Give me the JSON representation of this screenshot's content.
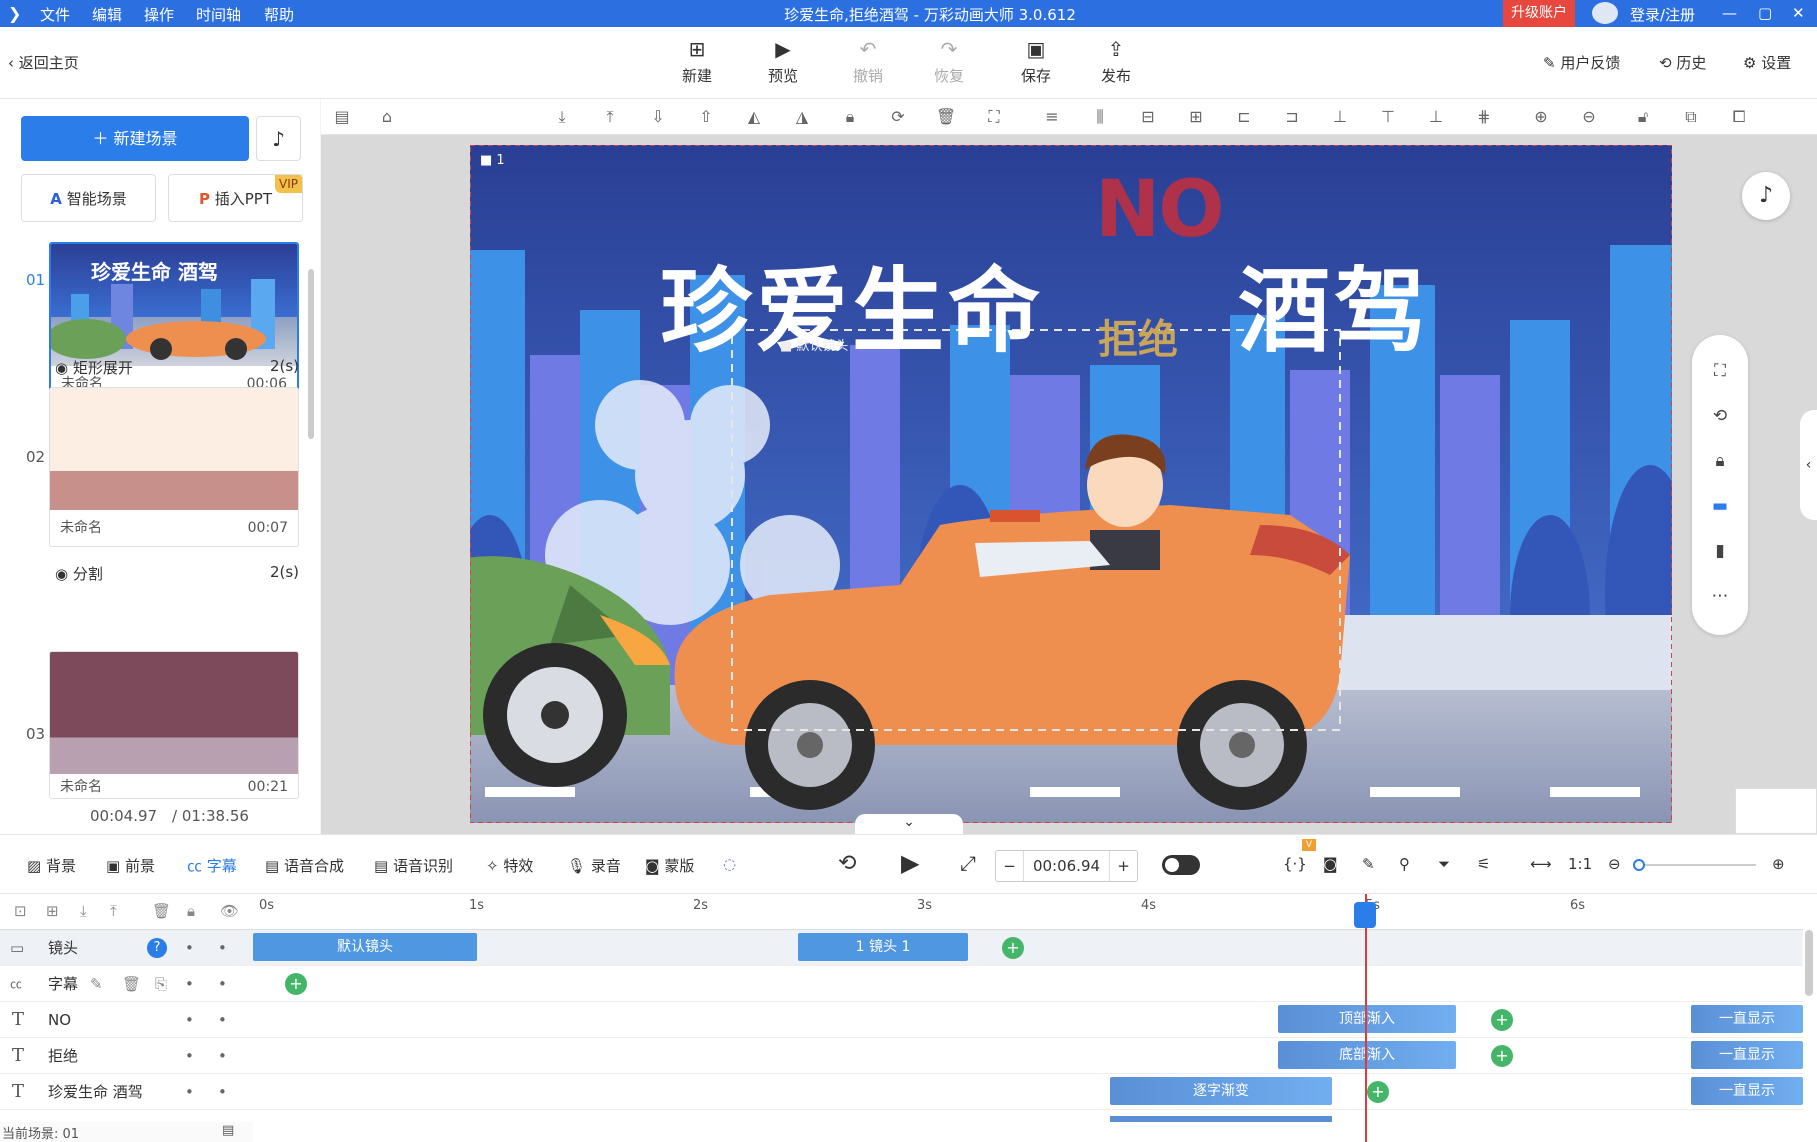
{
  "titlebar": {
    "menus": [
      "文件",
      "编辑",
      "操作",
      "时间轴",
      "帮助"
    ],
    "title": "珍爱生命,拒绝酒驾 - 万彩动画大师 3.0.612",
    "upgrade": "升级账户",
    "login": "登录/注册"
  },
  "toolbar": {
    "back": "返回主页",
    "new": "新建",
    "preview": "预览",
    "undo": "撤销",
    "redo": "恢复",
    "save": "保存",
    "publish": "发布",
    "feedback": "用户反馈",
    "history": "历史",
    "settings": "设置"
  },
  "left": {
    "new_scene": "新建场景",
    "smart_scene": "智能场景",
    "insert_ppt": "插入PPT",
    "vip": "VIP",
    "scenes": [
      {
        "num": "01",
        "name": "未命名",
        "dur": "00:06"
      },
      {
        "num": "02",
        "name": "未命名",
        "dur": "00:07"
      },
      {
        "num": "03",
        "name": "未命名",
        "dur": "00:21"
      }
    ],
    "transitions": [
      {
        "name": "矩形展开",
        "dur": "2(s)"
      },
      {
        "name": "分割",
        "dur": "2(s)"
      }
    ],
    "current_time": "00:04.97",
    "total_time": "/ 01:38.56"
  },
  "stage": {
    "camera_index": "1",
    "no_text": "NO",
    "main_left": "珍爱生命",
    "main_right": "酒驾",
    "refuse": "拒绝",
    "camera_label": "默认镜头"
  },
  "tabs": [
    "背景",
    "前景",
    "字幕",
    "语音合成",
    "语音识别",
    "特效",
    "录音",
    "蒙版"
  ],
  "playback": {
    "time": "00:06.94",
    "v_badge": "V"
  },
  "timeline": {
    "ticks": [
      "0s",
      "1s",
      "2s",
      "3s",
      "4s",
      "5s",
      "6s"
    ],
    "tracks": [
      {
        "name": "镜头"
      },
      {
        "name": "字幕"
      },
      {
        "name": "NO"
      },
      {
        "name": "拒绝"
      },
      {
        "name": "珍爱生命  酒驾"
      }
    ],
    "clips": {
      "cam_default": "默认镜头",
      "cam_1": "1 镜头 1",
      "top_in": "顶部渐入",
      "bottom_in": "底部渐入",
      "char_fade": "逐字渐变",
      "always": "一直显示"
    },
    "status": "当前场景: 01"
  }
}
